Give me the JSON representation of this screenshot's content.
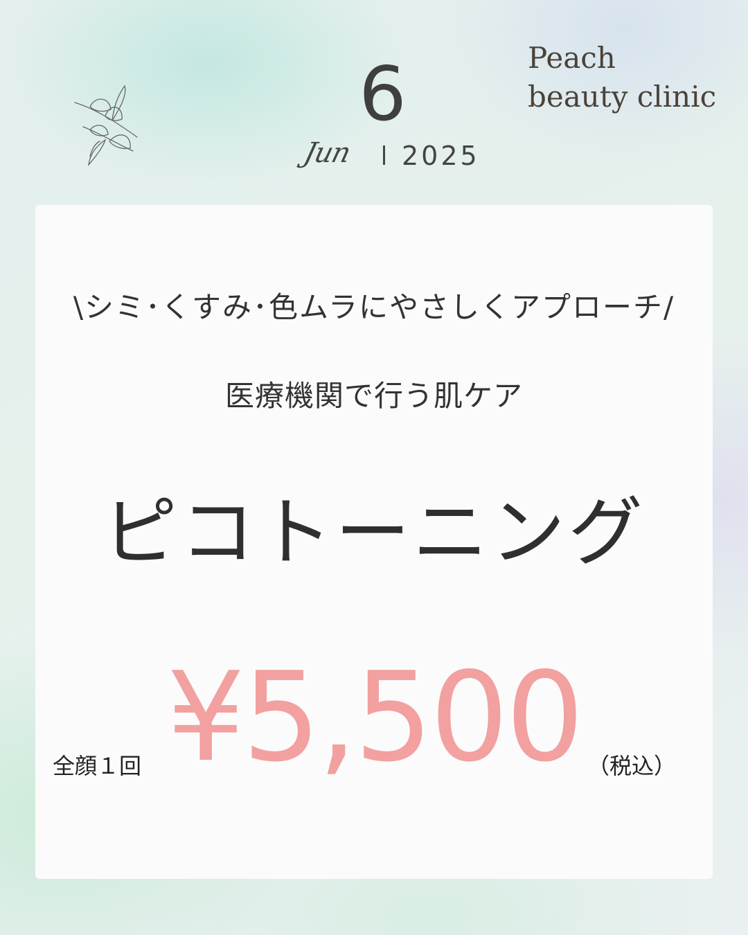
{
  "header": {
    "day": "6",
    "month": "Jun",
    "year": "2025",
    "brand_line1": "Peach",
    "brand_line2": "beauty clinic",
    "decoration_icon": "leaf-branch-icon"
  },
  "card": {
    "tagline": "\\シミ･くすみ･色ムラにやさしくアプローチ/",
    "subtitle": "医療機関で行う肌ケア",
    "treatment_name": "ピコトーニング",
    "price_prefix": "全顔１回",
    "price": "¥5,500",
    "price_suffix": "（税込）"
  },
  "colors": {
    "price": "#f2a0a0",
    "text": "#333333",
    "brand": "#4a4238",
    "card": "#fbfbfb"
  }
}
